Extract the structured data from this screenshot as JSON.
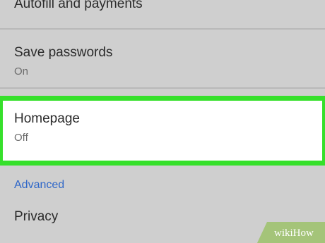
{
  "settings": {
    "autofill": {
      "title": "Autofill and payments"
    },
    "save_passwords": {
      "title": "Save passwords",
      "status": "On"
    },
    "homepage": {
      "title": "Homepage",
      "status": "Off"
    },
    "advanced_header": "Advanced",
    "privacy": {
      "title": "Privacy"
    }
  },
  "watermark": {
    "text": "wikiHow"
  },
  "colors": {
    "background": "#cfcfcf",
    "highlight": "#36e02b",
    "section_header": "#2f67c8"
  }
}
